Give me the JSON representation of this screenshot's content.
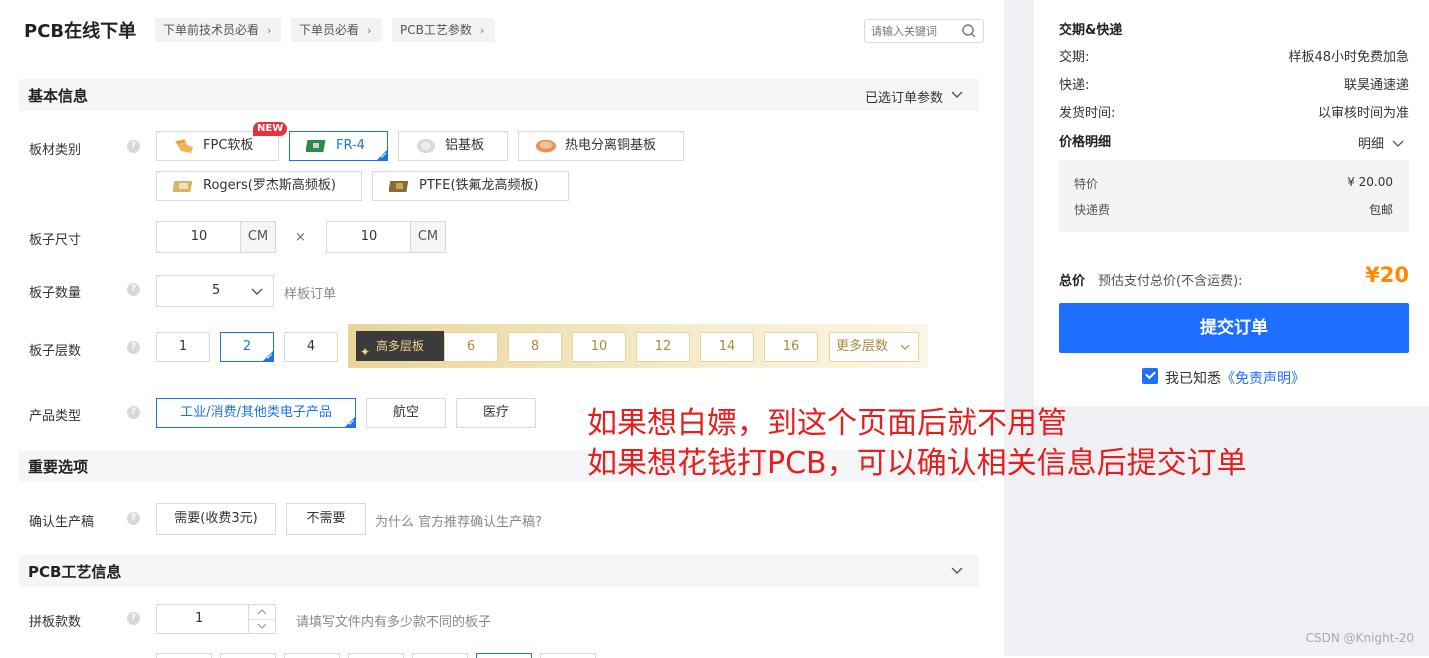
{
  "header": {
    "title": "PCB在线下单",
    "breadcrumbs": [
      "下单前技术员必看",
      "下单员必看",
      "PCB工艺参数"
    ],
    "search_placeholder": "请输入关键词"
  },
  "sections": {
    "basic": {
      "title": "基本信息",
      "right": "已选订单参数"
    },
    "important": {
      "title": "重要选项"
    },
    "process": {
      "title": "PCB工艺信息"
    }
  },
  "material": {
    "label": "板材类别",
    "options": [
      "FPC软板",
      "FR-4",
      "铝基板",
      "热电分离铜基板",
      "Rogers(罗杰斯高频板)",
      "PTFE(铁氟龙高频板)"
    ],
    "new_badge": "NEW",
    "selected": "FR-4"
  },
  "size": {
    "label": "板子尺寸",
    "width": "10",
    "height": "10",
    "unit": "CM",
    "times": "×"
  },
  "quantity": {
    "label": "板子数量",
    "value": "5",
    "hint": "样板订单"
  },
  "layers": {
    "label": "板子层数",
    "options": [
      "1",
      "2",
      "4"
    ],
    "selected": "2",
    "multi_tag": "高多层板",
    "multi_options": [
      "6",
      "8",
      "10",
      "12",
      "14",
      "16"
    ],
    "more": "更多层数"
  },
  "product": {
    "label": "产品类型",
    "options": [
      "工业/消费/其他类电子产品",
      "航空",
      "医疗"
    ],
    "selected": "工业/消费/其他类电子产品"
  },
  "confirm": {
    "label": "确认生产稿",
    "options": [
      "需要(收费3元)",
      "不需要"
    ],
    "hint": "为什么 官方推荐确认生产稿?"
  },
  "panel": {
    "label": "拼板款数",
    "value": "1",
    "hint": "请填写文件内有多少款不同的板子"
  },
  "annotation": {
    "line1": "如果想白嫖，到这个页面后就不用管",
    "line2": "如果想花钱打PCB，可以确认相关信息后提交订单"
  },
  "right": {
    "delivery_title": "交期&快递",
    "rows": [
      {
        "k": "交期:",
        "v": "样板48小时免费加急"
      },
      {
        "k": "快递:",
        "v": "联昊通速递"
      },
      {
        "k": "发货时间:",
        "v": "以审核时间为准"
      }
    ],
    "price_title": "价格明细",
    "price_toggle": "明细",
    "price_rows": [
      {
        "k": "特价",
        "v": "¥ 20.00"
      },
      {
        "k": "快递费",
        "v": "包邮"
      }
    ],
    "total_label": "总价",
    "total_note": "预估支付总价(不含运费):",
    "total_value": "¥20",
    "submit": "提交订单",
    "agree_prefix": "我已知悉",
    "agree_link": "《免责声明》"
  },
  "watermark": "CSDN @Knight-20",
  "colors": {
    "primary": "#1e6fff",
    "orange": "#ff8a00",
    "annotation": "#e61e1e"
  }
}
